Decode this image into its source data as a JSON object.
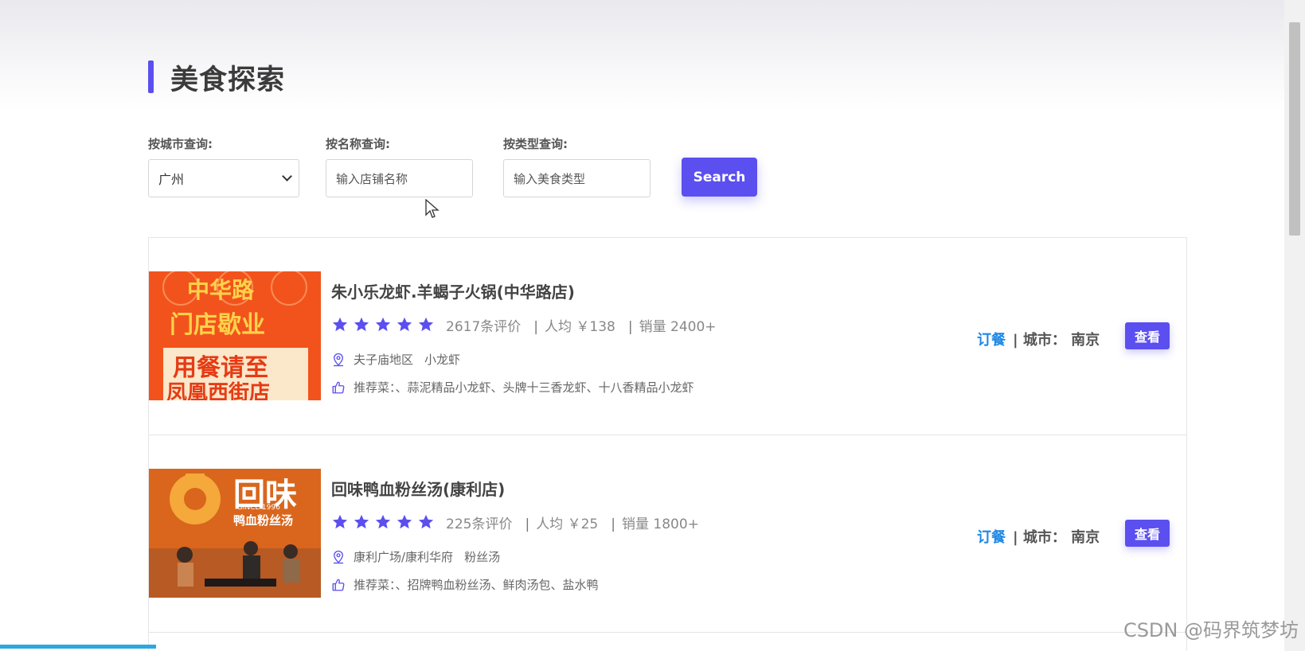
{
  "page": {
    "title": "美食探索"
  },
  "filters": {
    "city_label": "按城市查询:",
    "city_value": "广州",
    "name_label": "按名称查询:",
    "name_placeholder": "输入店铺名称",
    "type_label": "按类型查询:",
    "type_placeholder": "输入美食类型",
    "search_label": "Search"
  },
  "items": [
    {
      "name": "朱小乐龙虾.羊蝎子火锅(中华路店)",
      "rating_stars": 5,
      "reviews": "2617条评价",
      "avg_price": "人均 ￥138",
      "sales": "销量 2400+",
      "area": "夫子庙地区",
      "category": "小龙虾",
      "recommend": "推荐菜：、蒜泥精品小龙虾、头牌十三香龙虾、十八香精品小龙虾",
      "order_label": "订餐",
      "city_text": "| 城市：  南京",
      "view_label": "查看",
      "thumb_text": [
        "中华路",
        "门店歇业",
        "用餐请至",
        "凤凰西街店"
      ]
    },
    {
      "name": "回味鸭血粉丝汤(康利店)",
      "rating_stars": 5,
      "reviews": "225条评价",
      "avg_price": "人均 ￥25",
      "sales": "销量 1800+",
      "area": "康利广场/康利华府",
      "category": "粉丝汤",
      "recommend": "推荐菜：、招牌鸭血粉丝汤、鲜肉汤包、盐水鸭",
      "order_label": "订餐",
      "city_text": "| 城市：  南京",
      "view_label": "查看",
      "thumb_text": [
        "回味",
        "SINCE 1996",
        "鸭血粉丝汤"
      ]
    }
  ],
  "separator": "|",
  "watermark": "CSDN @码界筑梦坊",
  "colors": {
    "accent": "#5b4ff0",
    "link": "#1e88e5",
    "thumb1": "#f2531d",
    "thumb2": "#d9661c"
  },
  "icons": {
    "location": "location-pin-icon",
    "recommend": "thumbs-up-icon",
    "star": "star-icon"
  }
}
